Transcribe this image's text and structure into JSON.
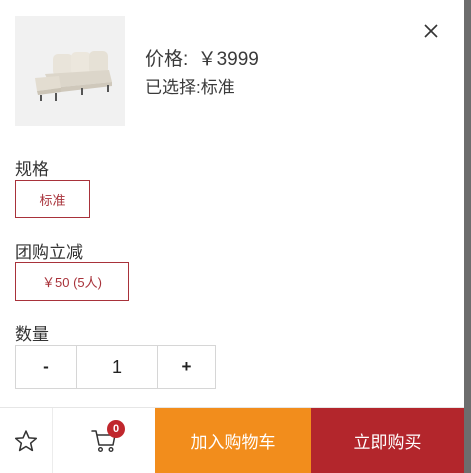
{
  "product": {
    "price_label": "价格:",
    "price_value": "￥3999",
    "selected_label": "已选择:",
    "selected_value": "标准",
    "image_icon": "sofa-image"
  },
  "spec": {
    "title": "规格",
    "options": [
      "标准"
    ]
  },
  "group_discount": {
    "title": "团购立减",
    "options": [
      "￥50 (5人)"
    ]
  },
  "quantity": {
    "title": "数量",
    "minus": "-",
    "value": "1",
    "plus": "+"
  },
  "bottom_bar": {
    "favorite_icon": "star-icon",
    "cart_icon": "cart-icon",
    "cart_badge": "0",
    "add_to_cart": "加入购物车",
    "buy_now": "立即购买"
  },
  "colors": {
    "accent_red": "#b3262c",
    "accent_orange": "#f28d1c",
    "chip_border": "#a8323a"
  }
}
